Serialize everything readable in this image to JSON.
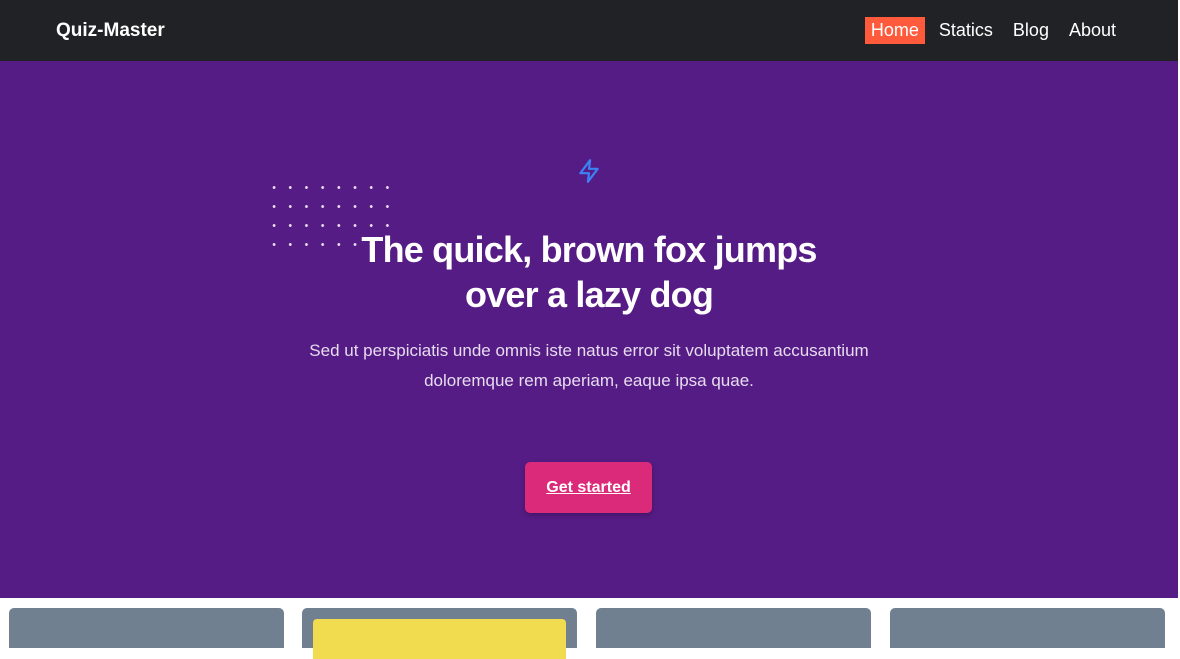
{
  "nav": {
    "brand": "Quiz-Master",
    "links": [
      {
        "label": "Home",
        "active": true
      },
      {
        "label": "Statics",
        "active": false
      },
      {
        "label": "Blog",
        "active": false
      },
      {
        "label": "About",
        "active": false
      }
    ]
  },
  "hero": {
    "icon": "lightning-bolt-icon",
    "title_line1": "The quick, brown fox jumps",
    "title_line2": "over a lazy dog",
    "subtitle_line1": "Sed ut perspiciatis unde omnis iste natus error sit voluptatem accusantium",
    "subtitle_line2": "doloremque rem aperiam, eaque ipsa quae.",
    "cta_label": "Get started"
  },
  "colors": {
    "navbar_bg": "#202225",
    "hero_bg": "#561c85",
    "active_nav": "#ff5a3c",
    "cta_bg": "#dc2a7a",
    "card_bg": "#708090",
    "card_highlight": "#f0dc4e",
    "bolt_icon": "#3b82f6"
  }
}
